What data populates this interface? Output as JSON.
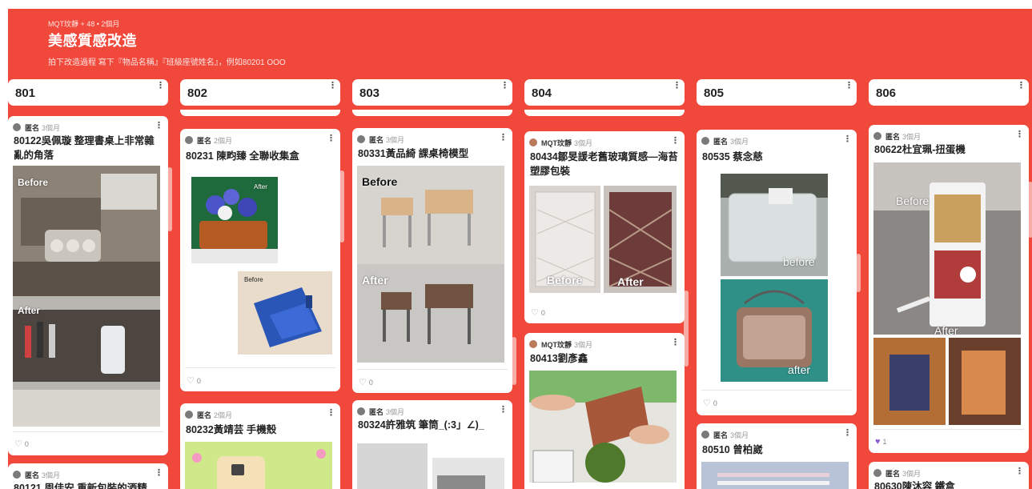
{
  "board": {
    "meta": "MQT玟靜 + 48 • 2個月",
    "title": "美感質感改造",
    "description": "拍下改造過程 寫下『物品名稱』『班級座號姓名』，例如80201 OOO"
  },
  "columns": [
    {
      "name": "801"
    },
    {
      "name": "802"
    },
    {
      "name": "803"
    },
    {
      "name": "804"
    },
    {
      "name": "805"
    },
    {
      "name": "806"
    }
  ],
  "posts": {
    "c1_1": {
      "author": "匿名",
      "time": "3個月",
      "title": "80122吳佩璇 整理書桌上非常雜亂的角落",
      "img_before": "Before",
      "img_after": "After",
      "likes": "0"
    },
    "c1_2": {
      "author": "匿名",
      "time": "3個月",
      "title": "80121 周佳安 重新包裝的酒精"
    },
    "c2_1": {
      "author": "匿名",
      "time": "2個月",
      "title": "80231 陳畇臻 全聯收集盒",
      "img_after": "After",
      "img_before": "Before",
      "likes": "0"
    },
    "c2_2": {
      "author": "匿名",
      "time": "2個月",
      "title": "80232黃靖芸 手機殼"
    },
    "c3_1": {
      "author": "匿名",
      "time": "3個月",
      "title": "80331黃品綺 課桌椅模型",
      "img_before": "Before",
      "img_after": "After",
      "likes": "0"
    },
    "c3_2": {
      "author": "匿名",
      "time": "3個月",
      "title": "80324許雅筑 筆筒_(:3」∠)_"
    },
    "c4_1": {
      "author": "MQT玟靜",
      "time": "3個月",
      "title": "80434鄒旻諼老舊玻璃質感—海苔塑膠包裝",
      "img_before": "Before",
      "img_after": "After",
      "likes": "0"
    },
    "c4_2": {
      "author": "MQT玟靜",
      "time": "3個月",
      "title": "80413劉彥鑫"
    },
    "c5_1": {
      "author": "匿名",
      "time": "3個月",
      "title": "80535 蔡念慈",
      "img_before": "before",
      "img_after": "after",
      "likes": "0"
    },
    "c5_2": {
      "author": "匿名",
      "time": "3個月",
      "title": "80510 曾柏崴"
    },
    "c6_1": {
      "author": "匿名",
      "time": "3個月",
      "title": "80622杜宜珮-扭蛋機",
      "img_before": "Before",
      "img_after": "After",
      "likes": "1"
    },
    "c6_2": {
      "author": "匿名",
      "time": "3個月",
      "title": "80630陳沐容 鐵盒"
    }
  },
  "icons": {
    "menu": "more-vertical-icon",
    "like": "heart-icon"
  },
  "colors": {
    "board_bg": "#f0483a",
    "like_active": "#8b5bd6"
  }
}
